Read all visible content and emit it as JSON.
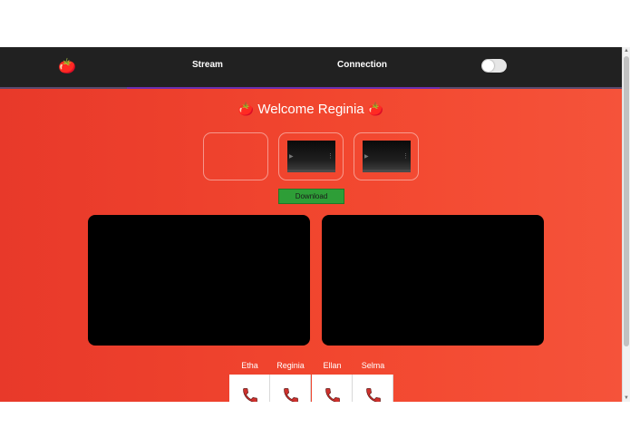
{
  "navbar": {
    "logo": "🍅",
    "links": [
      "Stream",
      "Connection"
    ],
    "theme_toggle_on": false
  },
  "welcome": {
    "emoji": "🍅",
    "text": "Welcome Reginia"
  },
  "clips": {
    "download_label": "Download"
  },
  "contacts": [
    "Etha",
    "Reginia",
    "Ellan",
    "Selma"
  ],
  "colors": {
    "navbar_bg": "#212121",
    "page_bg": "#ec3d2c",
    "download_bg": "#2e9e37",
    "video_bg": "#000000",
    "call_icon": "#d0312d"
  }
}
